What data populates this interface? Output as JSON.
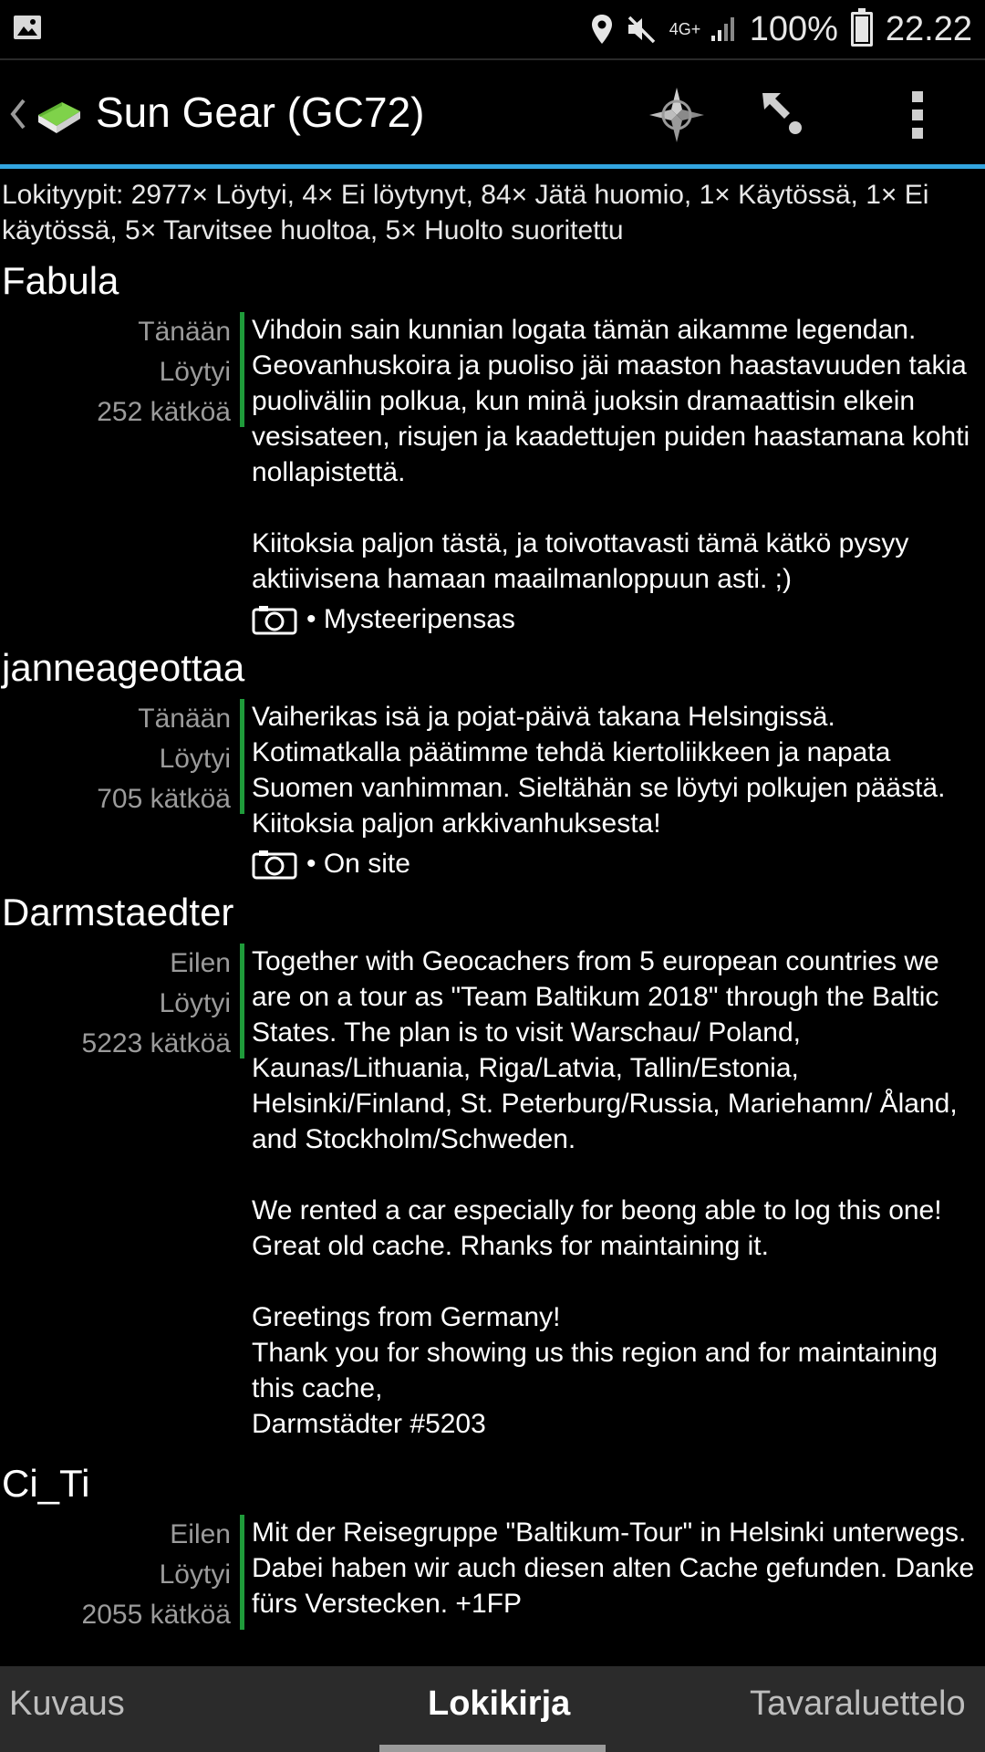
{
  "status_bar": {
    "battery": "100%",
    "time": "22.22",
    "network": "4G+",
    "icons": [
      "gallery-icon",
      "location-icon",
      "mute-icon",
      "signal-icon",
      "battery-icon"
    ]
  },
  "app_bar": {
    "title": "Sun Gear (GC72)",
    "icons": [
      "back-chevron-icon",
      "cache-book-icon",
      "compass-icon",
      "navigate-icon",
      "overflow-menu-icon"
    ],
    "accent_color": "#33a5e0"
  },
  "summary": "Lokityypit: 2977× Löytyi, 4× Ei löytynyt, 84× Jätä huomio, 1× Käytössä, 1× Ei käytössä, 5× Tarvitsee huoltoa, 5× Huolto suoritettu",
  "logs": [
    {
      "author": "Fabula",
      "date": "Tänään",
      "type": "Löytyi",
      "finds": "252 kätköä",
      "text": "Vihdoin sain kunnian logata tämän aikamme legendan. Geovanhuskoira ja puoliso jäi maaston haastavuuden takia puoliväliin polkua, kun minä juoksin dramaattisin elkein vesisateen, risujen ja kaadettujen puiden haastamana kohti nollapistettä.\n\nKiitoksia paljon tästä, ja toivottavasti tämä kätkö pysyy aktiivisena hamaan maailmanloppuun asti. ;)",
      "image_caption": "• Mysteeripensas"
    },
    {
      "author": "janneageottaa",
      "date": "Tänään",
      "type": "Löytyi",
      "finds": "705 kätköä",
      "text": "Vaiherikas isä ja pojat-päivä takana Helsingissä. Kotimatkalla päätimme tehdä kiertoliikkeen ja napata Suomen vanhimman. Sieltähän se löytyi polkujen päästä. Kiitoksia paljon arkkivanhuksesta!",
      "image_caption": "• On site"
    },
    {
      "author": "Darmstaedter",
      "date": "Eilen",
      "type": "Löytyi",
      "finds": "5223 kätköä",
      "text": "Together with Geocachers from 5 european countries we are on a tour as \"Team Baltikum 2018\" through the Baltic States. The plan is to visit Warschau/ Poland, Kaunas/Lithuania, Riga/Latvia, Tallin/Estonia, Helsinki/Finland, St. Peterburg/Russia, Mariehamn/ Åland, and Stockholm/Schweden.\n\nWe rented a car especially for beong able to log this one! Great old cache. Rhanks for maintaining it.\n\nGreetings from Germany!\nThank you for showing us this region and for maintaining this cache,\nDarmstädter #5203",
      "image_caption": ""
    },
    {
      "author": "Ci_Ti",
      "date": "Eilen",
      "type": "Löytyi",
      "finds": "2055 kätköä",
      "text": "Mit der Reisegruppe \"Baltikum-Tour\" in Helsinki unterwegs. Dabei haben wir auch diesen alten Cache gefunden. Danke fürs Verstecken. +1FP",
      "image_caption": ""
    }
  ],
  "tabs": [
    {
      "label": "Kuvaus",
      "active": false
    },
    {
      "label": "Lokikirja",
      "active": true
    },
    {
      "label": "Tavaraluettelo",
      "active": false
    }
  ],
  "colors": {
    "found_bar": "#1f9b3a",
    "meta_text": "#9b9b9b",
    "tab_bg": "#2b2b2b"
  }
}
